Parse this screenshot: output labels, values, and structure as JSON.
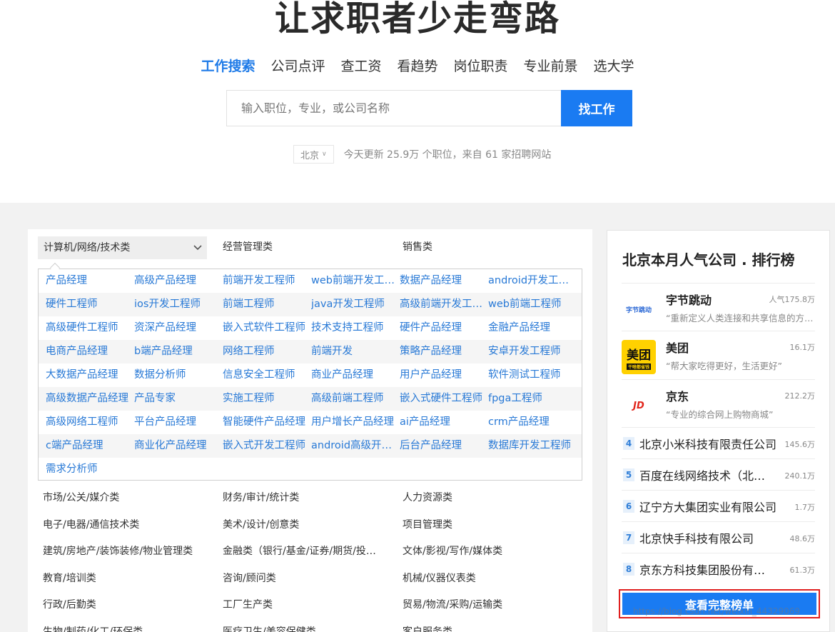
{
  "hero": {
    "title": "让求职者少走弯路",
    "nav": [
      "工作搜索",
      "公司点评",
      "查工资",
      "看趋势",
      "岗位职责",
      "专业前景",
      "选大学"
    ],
    "search_placeholder": "输入职位，专业，或公司名称",
    "search_button": "找工作",
    "city": "北京",
    "update_text": "今天更新 25.9万 个职位，来自 61 家招聘网站"
  },
  "categories": {
    "top": [
      "计算机/网络/技术类",
      "经营管理类",
      "销售类"
    ],
    "jobs": [
      [
        "产品经理",
        "高级产品经理",
        "前端开发工程师",
        "web前端开发工程师",
        "数据产品经理",
        "android开发工程师"
      ],
      [
        "硬件工程师",
        "ios开发工程师",
        "前端工程师",
        "java开发工程师",
        "高级前端开发工程师",
        "web前端工程师"
      ],
      [
        "高级硬件工程师",
        "资深产品经理",
        "嵌入式软件工程师",
        "技术支持工程师",
        "硬件产品经理",
        "金融产品经理"
      ],
      [
        "电商产品经理",
        "b端产品经理",
        "网络工程师",
        "前端开发",
        "策略产品经理",
        "安卓开发工程师"
      ],
      [
        "大数据产品经理",
        "数据分析师",
        "信息安全工程师",
        "商业产品经理",
        "用户产品经理",
        "软件测试工程师"
      ],
      [
        "高级数据产品经理",
        "产品专家",
        "实施工程师",
        "高级前端工程师",
        "嵌入式硬件工程师",
        "fpga工程师"
      ],
      [
        "高级网络工程师",
        "平台产品经理",
        "智能硬件产品经理",
        "用户增长产品经理",
        "ai产品经理",
        "crm产品经理"
      ],
      [
        "c端产品经理",
        "商业化产品经理",
        "嵌入式开发工程师",
        "android高级开发工程师",
        "后台产品经理",
        "数据库开发工程师"
      ],
      [
        "需求分析师"
      ]
    ],
    "rows": [
      [
        "市场/公关/媒介类",
        "财务/审计/统计类",
        "人力资源类"
      ],
      [
        "电子/电器/通信技术类",
        "美术/设计/创意类",
        "项目管理类"
      ],
      [
        "建筑/房地产/装饰装修/物业管理类",
        "金融类（银行/基金/证券/期货/投资）",
        "文体/影视/写作/媒体类"
      ],
      [
        "教育/培训类",
        "咨询/顾问类",
        "机械/仪器仪表类"
      ],
      [
        "行政/后勤类",
        "工厂生产类",
        "贸易/物流/采购/运输类"
      ],
      [
        "生物/制药/化工/环保类",
        "医疗卫生/美容保健类",
        "客户服务类"
      ]
    ]
  },
  "ranking": {
    "title": "北京本月人气公司 . 排行榜",
    "top3": [
      {
        "name": "字节跳动",
        "pop": "人气175.8万",
        "desc": "“重新定义人类连接和共享信息的方式”",
        "logo": "字节跳动"
      },
      {
        "name": "美团",
        "pop": "16.1万",
        "desc": "“帮大家吃得更好，生活更好”",
        "logo": "美团",
        "logo_sub": "干啥都省钱"
      },
      {
        "name": "京东",
        "pop": "212.2万",
        "desc": "“专业的综合网上购物商城”",
        "logo": "JD"
      }
    ],
    "others": [
      {
        "rank": "4",
        "name": "北京小米科技有限责任公司",
        "pop": "145.6万"
      },
      {
        "rank": "5",
        "name": "百度在线网络技术（北京）有限公司",
        "pop": "240.1万"
      },
      {
        "rank": "6",
        "name": "辽宁方大集团实业有限公司",
        "pop": "1.7万"
      },
      {
        "rank": "7",
        "name": "北京快手科技有限公司",
        "pop": "48.6万"
      },
      {
        "rank": "8",
        "name": "京东方科技集团股份有限公司",
        "pop": "61.3万"
      }
    ],
    "full_button": "查看完整榜单"
  },
  "watermark": "https://blog.csdn.net/weixin_44329069",
  "colors": {
    "accent": "#1a7bf2",
    "link": "#2879d6",
    "highlight_border": "#e02020"
  }
}
